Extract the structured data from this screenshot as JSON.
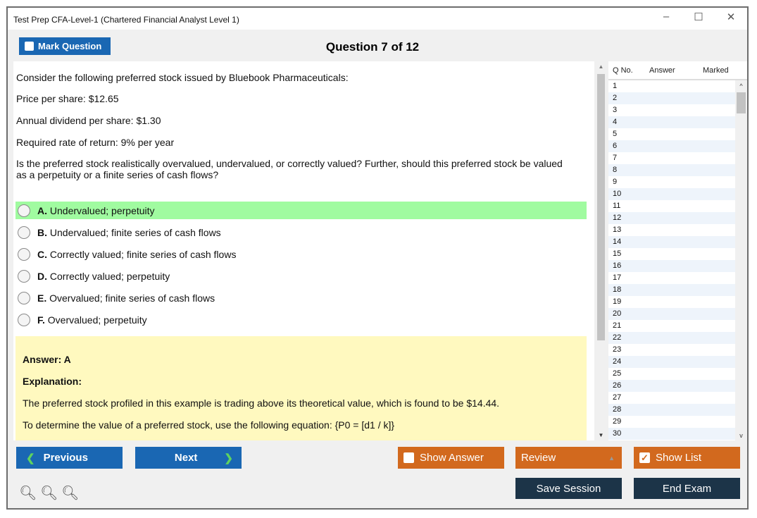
{
  "window": {
    "title": "Test Prep CFA-Level-1 (Chartered Financial Analyst Level 1)",
    "minimize": "–",
    "maximize": "☐",
    "close": "✕"
  },
  "toolbar": {
    "mark_label": "Mark Question",
    "question_title": "Question 7 of 12"
  },
  "question": {
    "stem": "Consider the following preferred stock issued by Bluebook Pharmaceuticals:",
    "price": "Price per share: $12.65",
    "dividend": "Annual dividend per share: $1.30",
    "rate": "Required rate of return: 9% per year",
    "prompt": "Is the preferred stock realistically overvalued, undervalued, or correctly valued? Further, should this preferred stock be valued as a perpetuity or a finite series of cash flows?",
    "options": [
      {
        "letter": "A.",
        "text": "Undervalued; perpetuity",
        "correct": true
      },
      {
        "letter": "B.",
        "text": "Undervalued; finite series of cash flows"
      },
      {
        "letter": "C.",
        "text": "Correctly valued; finite series of cash flows"
      },
      {
        "letter": "D.",
        "text": "Correctly valued; perpetuity"
      },
      {
        "letter": "E.",
        "text": "Overvalued; finite series of cash flows"
      },
      {
        "letter": "F.",
        "text": "Overvalued; perpetuity"
      }
    ]
  },
  "answer": {
    "answer_label": "Answer: A",
    "explanation_label": "Explanation:",
    "line1": "The preferred stock profiled in this example is trading above its theoretical value, which is found to be $14.44.",
    "line2": "To determine the value of a preferred stock, use the following equation: {P0 = [d1 / k]}"
  },
  "list": {
    "headers": [
      "Q No.",
      "Answer",
      "Marked"
    ],
    "rows": [
      "1",
      "2",
      "3",
      "4",
      "5",
      "6",
      "7",
      "8",
      "9",
      "10",
      "11",
      "12",
      "13",
      "14",
      "15",
      "16",
      "17",
      "18",
      "19",
      "20",
      "21",
      "22",
      "23",
      "24",
      "25",
      "26",
      "27",
      "28",
      "29",
      "30"
    ]
  },
  "footer": {
    "previous": "Previous",
    "next": "Next",
    "show_answer": "Show Answer",
    "review": "Review",
    "show_list": "Show List",
    "save_session": "Save Session",
    "end_exam": "End Exam"
  },
  "colors": {
    "correct_bg": "#a0fba0",
    "answer_bg": "#fff9bf",
    "blue": "#1a67b3",
    "orange": "#d2691e",
    "navy": "#1c3448"
  }
}
